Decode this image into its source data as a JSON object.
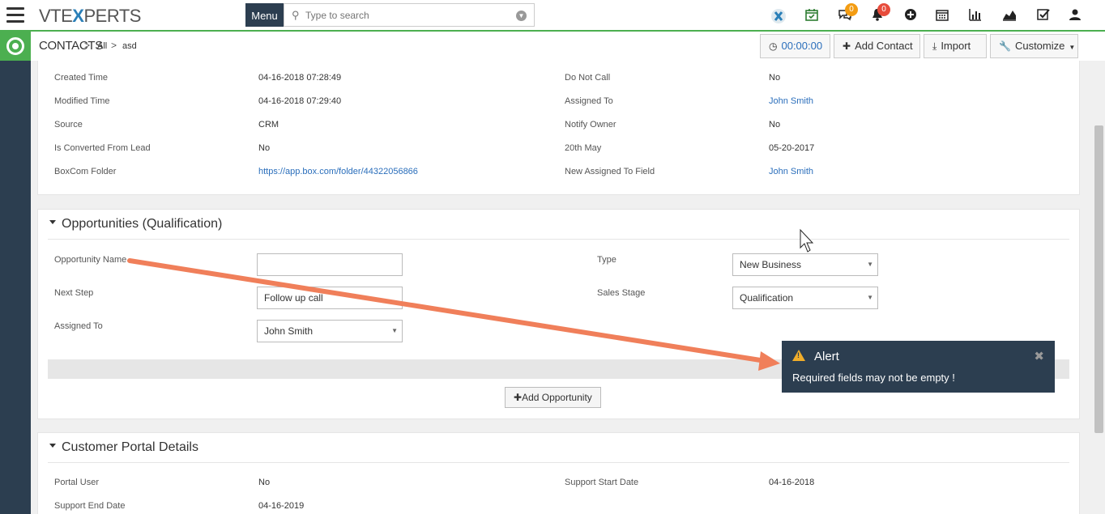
{
  "brand": {
    "logo_text_a": "VTE",
    "logo_text_x": "X",
    "logo_text_b": "PERTS"
  },
  "header": {
    "menu_label": "Menu",
    "search_placeholder": "Type to search",
    "chat_badge": "0",
    "notif_badge": "0",
    "badge_colors": {
      "chat": "#f39c12",
      "notif": "#e74c3c"
    }
  },
  "breadcrumb": {
    "module": "CONTACTS",
    "sep": ">",
    "level1": "All",
    "level2": "asd"
  },
  "actions": {
    "timer": "00:00:00",
    "add_contact": "Add Contact",
    "import": "Import",
    "customize": "Customize"
  },
  "details": {
    "left": [
      {
        "label": "Created Time",
        "value": "04-16-2018 07:28:49"
      },
      {
        "label": "Modified Time",
        "value": "04-16-2018 07:29:40"
      },
      {
        "label": "Source",
        "value": "CRM"
      },
      {
        "label": "Is Converted From Lead",
        "value": "No"
      },
      {
        "label": "BoxCom Folder",
        "value": "https://app.box.com/folder/44322056866"
      }
    ],
    "right": [
      {
        "label": "Do Not Call",
        "value": "No"
      },
      {
        "label": "Assigned To",
        "value": "John Smith"
      },
      {
        "label": "Notify Owner",
        "value": "No"
      },
      {
        "label": "20th May",
        "value": "05-20-2017"
      },
      {
        "label": "New Assigned To Field",
        "value": "John Smith"
      }
    ]
  },
  "opportunities": {
    "title": "Opportunities (Qualification)",
    "opp_name_label": "Opportunity Name",
    "opp_name_value": "",
    "next_step_label": "Next Step",
    "next_step_value": "Follow up call",
    "assigned_label": "Assigned To",
    "assigned_value": "John Smith",
    "type_label": "Type",
    "type_value": "New Business",
    "stage_label": "Sales Stage",
    "stage_value": "Qualification",
    "add_button": "Add Opportunity"
  },
  "portal": {
    "title": "Customer Portal Details",
    "portal_user_label": "Portal User",
    "portal_user_value": "No",
    "support_end_label": "Support End Date",
    "support_end_value": "04-16-2019",
    "support_start_label": "Support Start Date",
    "support_start_value": "04-16-2018"
  },
  "alert": {
    "title": "Alert",
    "message": "Required fields may not be empty !"
  },
  "annotation_arrow_color": "#f07f5a"
}
